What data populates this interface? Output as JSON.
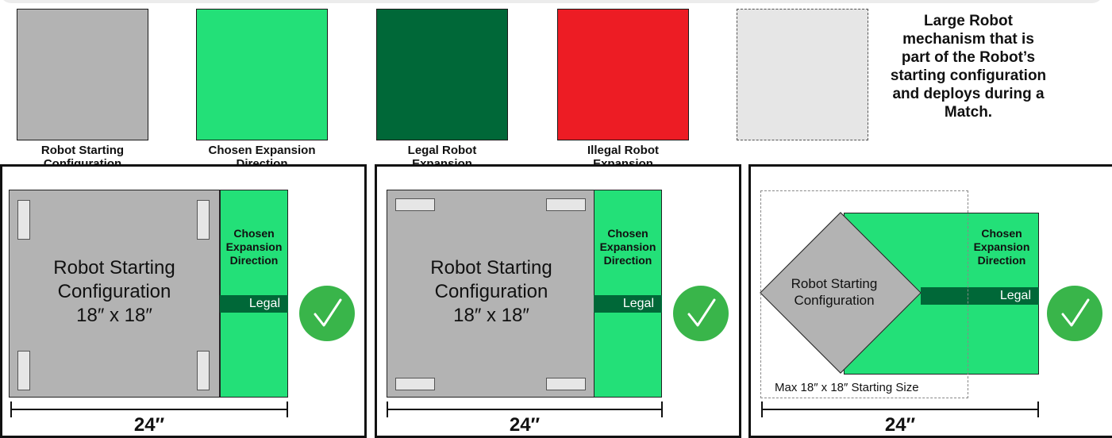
{
  "colors": {
    "gray": "#b3b3b3",
    "green": "#23e078",
    "dark": "#006838",
    "red": "#ed1c24",
    "check": "#39b54a"
  },
  "legend": {
    "robot_starting": "Robot Starting\nConfiguration",
    "chosen_expansion": "Chosen Expansion\nDirection",
    "legal_expansion": "Legal Robot\nExpansion",
    "illegal_expansion": "Illegal Robot\nExpansion",
    "mechanism_note": "Large Robot\nmechanism that is\npart of the Robot’s\nstarting configuration\nand deploys during a\nMatch."
  },
  "panels": [
    {
      "robot_label": "Robot Starting\nConfiguration\n18″ x 18″",
      "expansion_label": "Chosen\nExpansion\nDirection",
      "legal_label": "Legal",
      "dimension_label": "24″"
    },
    {
      "robot_label": "Robot Starting\nConfiguration\n18″ x 18″",
      "expansion_label": "Chosen\nExpansion\nDirection",
      "legal_label": "Legal",
      "dimension_label": "24″"
    },
    {
      "robot_label": "Robot Starting\nConfiguration",
      "expansion_label": "Chosen\nExpansion\nDirection",
      "legal_label": "Legal",
      "max_size_label": "Max 18″ x 18″ Starting Size",
      "dimension_label": "24″"
    }
  ]
}
